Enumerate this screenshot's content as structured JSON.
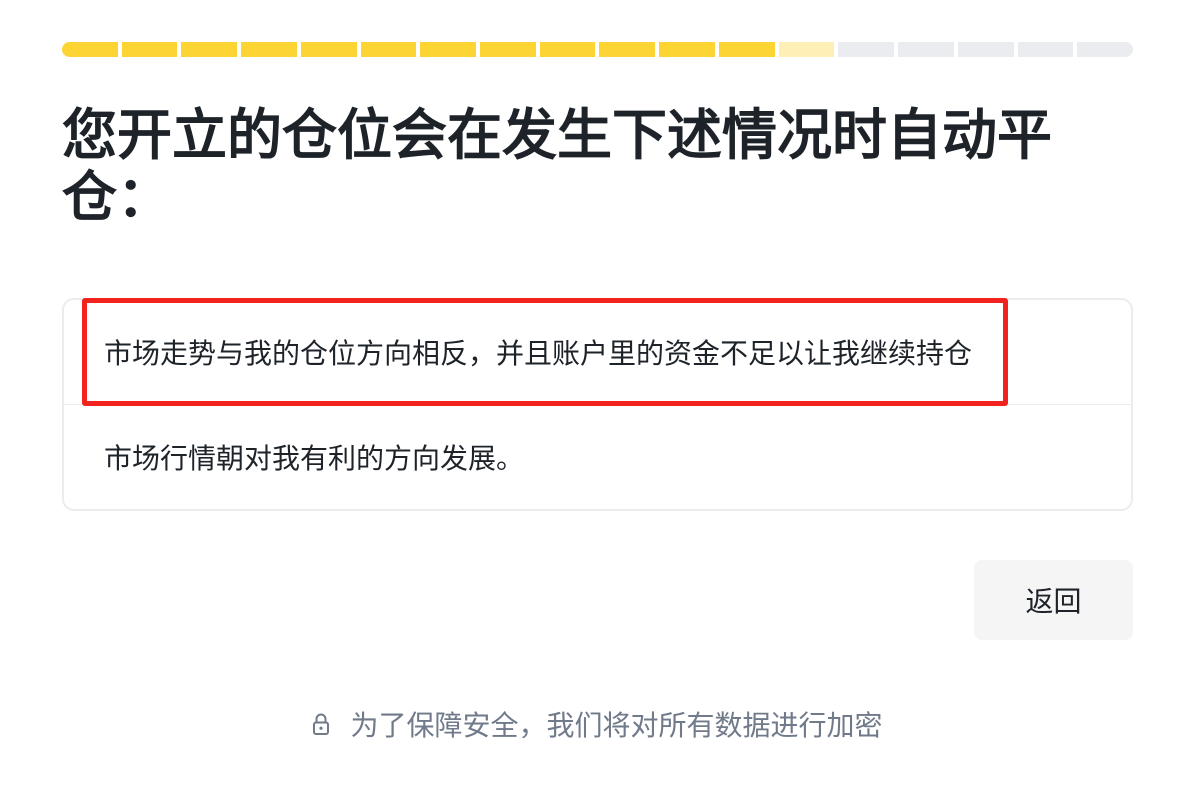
{
  "progress": {
    "total_steps": 18,
    "completed_steps": 12,
    "current_step": 13
  },
  "title": "您开立的仓位会在发生下述情况时自动平仓：",
  "options": [
    {
      "label": "市场走势与我的仓位方向相反，并且账户里的资金不足以让我继续持仓",
      "highlighted": true
    },
    {
      "label": "市场行情朝对我有利的方向发展。",
      "highlighted": false
    }
  ],
  "back_button": {
    "label": "返回"
  },
  "footer": {
    "icon": "lock-icon",
    "text": "为了保障安全，我们将对所有数据进行加密"
  },
  "colors": {
    "accent": "#fcd535",
    "progress_done": "#fcd535",
    "progress_current": "#fdefb6",
    "progress_todo": "#eaecef",
    "highlight": "#f2231f",
    "text_primary": "#1e2329",
    "text_secondary": "#707a8a"
  }
}
